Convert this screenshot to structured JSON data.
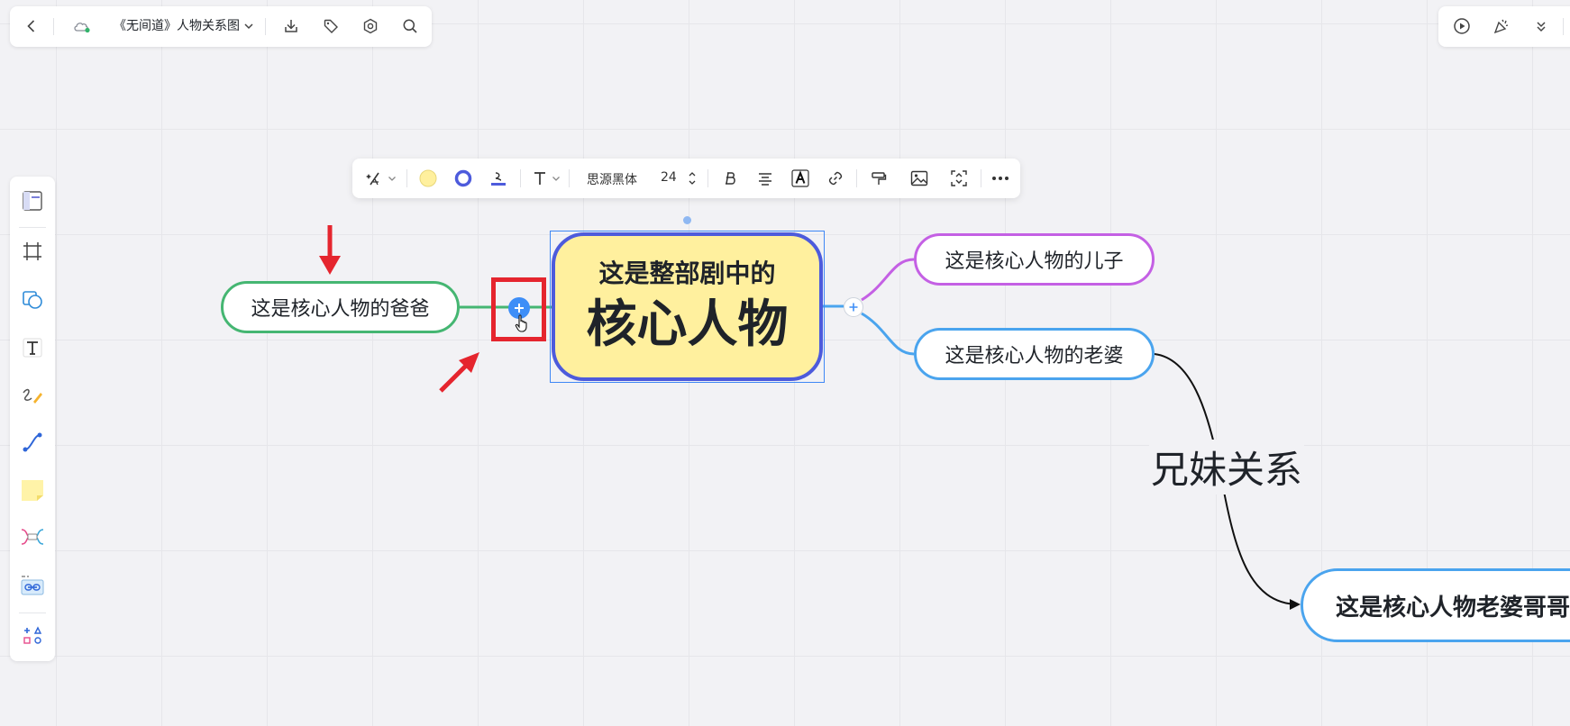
{
  "top_bar": {
    "document_title": "《无间道》人物关系图"
  },
  "format_toolbar": {
    "font_family": "思源黑体",
    "font_size": "24"
  },
  "mindmap": {
    "core_line1": "这是整部剧中的",
    "core_line2": "核心人物",
    "father": "这是核心人物的爸爸",
    "son": "这是核心人物的儿子",
    "wife": "这是核心人物的老婆",
    "brother": "这是核心人物老婆哥哥",
    "relation_label": "兄妹关系"
  },
  "colors": {
    "father_branch": "#45b672",
    "son_branch": "#c460e4",
    "wife_branch": "#4aa4ee",
    "core_fill": "#fff09e",
    "core_border": "#4d5bdc",
    "annotation_red": "#e5252e",
    "selection_blue": "#3e87f5"
  }
}
